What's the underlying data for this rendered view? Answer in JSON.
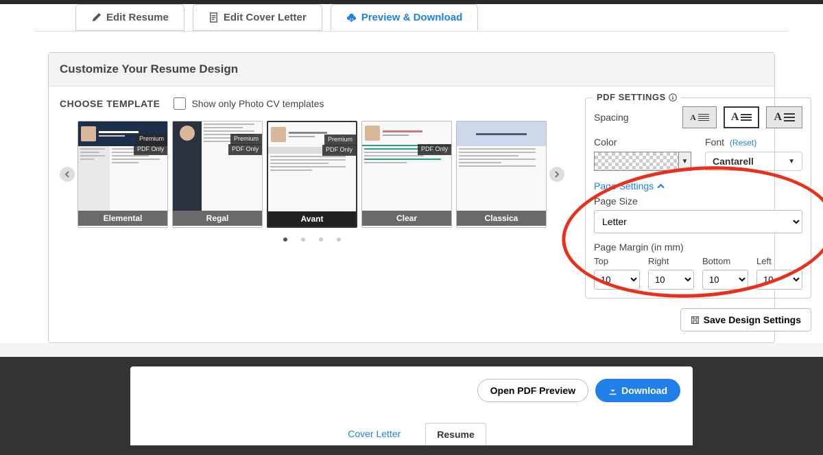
{
  "tabs": {
    "edit_resume": "Edit Resume",
    "edit_cover_letter": "Edit Cover Letter",
    "preview_download": "Preview & Download"
  },
  "panel_title": "Customize Your Resume Design",
  "choose_template": "CHOOSE TEMPLATE",
  "show_photo_only": "Show only Photo CV templates",
  "templates": [
    {
      "name": "Elemental",
      "premium": "Premium",
      "pdf_only": "PDF Only"
    },
    {
      "name": "Regal",
      "premium": "Premium",
      "pdf_only": "PDF Only"
    },
    {
      "name": "Avant",
      "premium": "Premium",
      "pdf_only": "PDF Only"
    },
    {
      "name": "Clear",
      "pdf_only": "PDF Only"
    },
    {
      "name": "Classica"
    }
  ],
  "pdf": {
    "title": "PDF SETTINGS",
    "spacing": "Spacing",
    "color": "Color",
    "font": "Font",
    "reset": "(Reset)",
    "font_value": "Cantarell",
    "page_settings": "Page Settings",
    "page_size": "Page Size",
    "page_size_value": "Letter",
    "page_margin": "Page Margin (in mm)",
    "margins": {
      "top": "Top",
      "right": "Right",
      "bottom": "Bottom",
      "left": "Left"
    },
    "margin_val": "10",
    "save": "Save Design Settings"
  },
  "preview": {
    "open_pdf": "Open PDF Preview",
    "download": "Download",
    "cover_letter": "Cover Letter",
    "resume": "Resume"
  }
}
